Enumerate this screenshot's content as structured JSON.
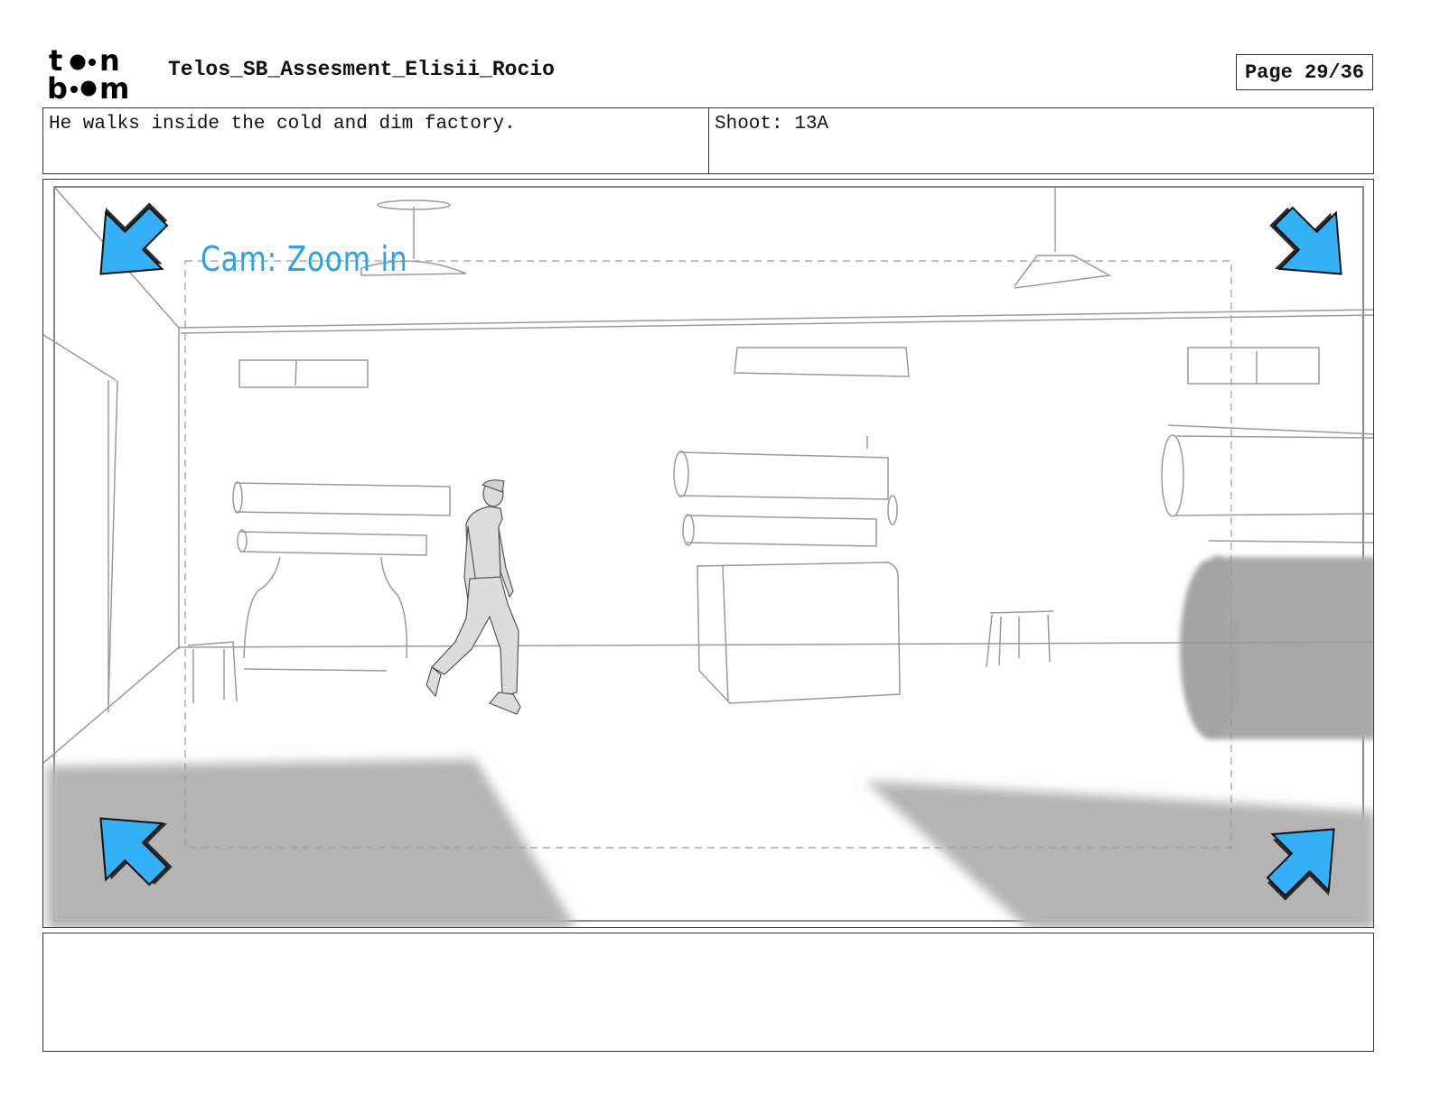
{
  "header": {
    "logo_top": "t",
    "logo_bottom": "b",
    "logo_brand": "toonboom",
    "project_title": "Telos_SB_Assesment_Elisii_Rocio",
    "page_label": "Page 29/36"
  },
  "panel": {
    "action_text": "He walks inside the cold and dim factory.",
    "shot_text": "Shoot: 13A",
    "camera_note": "Cam: Zoom in",
    "notes_text": ""
  },
  "colors": {
    "arrow_blue": "#34b0f6",
    "camera_note_blue": "#29a3e6",
    "shadow_gray": "#b4b4b4",
    "sketch_line": "#9a9a9a",
    "figure_fill": "#dcdcdc"
  },
  "icons": [
    "toonboom-logo",
    "zoom-arrow-icon"
  ]
}
